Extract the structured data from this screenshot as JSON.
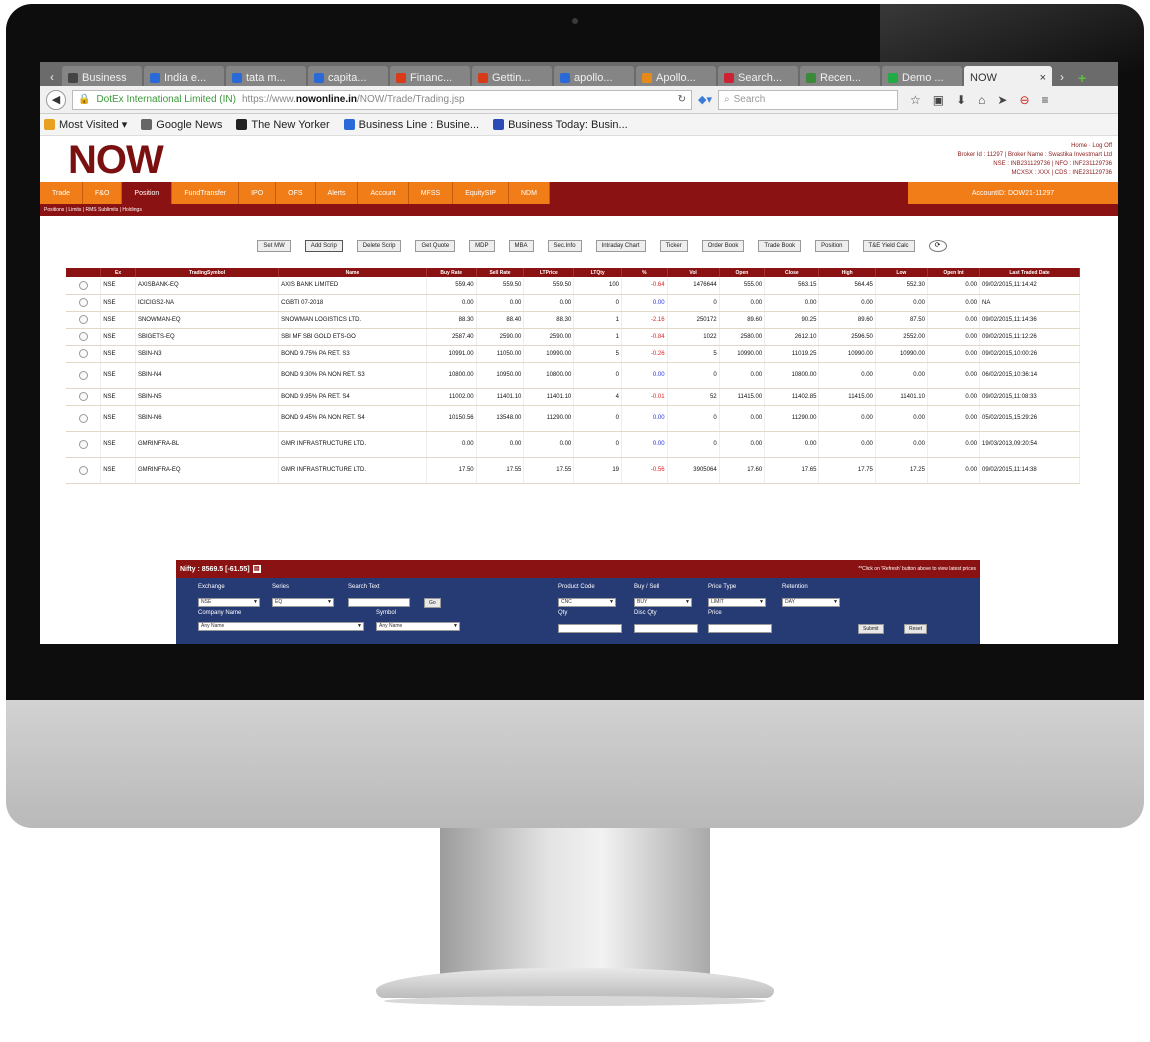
{
  "browser": {
    "tabs": [
      {
        "label": "Business",
        "color": "#444444"
      },
      {
        "label": "India e...",
        "color": "#2a6ad8"
      },
      {
        "label": "tata m...",
        "color": "#2a6ad8"
      },
      {
        "label": "capita...",
        "color": "#2a6ad8"
      },
      {
        "label": "Financ...",
        "color": "#d83a1a"
      },
      {
        "label": "Gettin...",
        "color": "#d83a1a"
      },
      {
        "label": "apollo...",
        "color": "#2a6ad8"
      },
      {
        "label": "Apollo...",
        "color": "#e88a1a"
      },
      {
        "label": "Search...",
        "color": "#cc2233"
      },
      {
        "label": "Recen...",
        "color": "#3a8a3a"
      },
      {
        "label": "Demo ...",
        "color": "#22aa44"
      }
    ],
    "active_tab": {
      "label": "NOW",
      "close": "×"
    },
    "url_site": "DotEx International Limited (IN)",
    "url_prefix": "https://www.",
    "url_host": "nowonline.in",
    "url_path": "/NOW/Trade/Trading.jsp",
    "search_placeholder": "Search",
    "bookmarks": [
      {
        "label": "Most Visited ▾",
        "color": "#e8a020"
      },
      {
        "label": "Google News",
        "color": "#666666"
      },
      {
        "label": "The New Yorker",
        "color": "#222222"
      },
      {
        "label": "Business Line : Busine...",
        "color": "#2a6ad8"
      },
      {
        "label": "Business Today: Busin...",
        "color": "#2a4ab8"
      }
    ]
  },
  "app": {
    "logo": "NOW",
    "user_line1": "Home · Log Off",
    "user_line2": "Broker Id : 11297 | Broker Name : Swastika Investmart Ltd",
    "user_line3": "NSE : INB231129736 | NFO : INF231129736",
    "user_line4": "MCXSX : XXX | CDS : INE231129736",
    "menu": [
      "Trade",
      "F&O",
      "Position",
      "FundTransfer",
      "IPO",
      "OFS",
      "Alerts",
      "Account",
      "MFSS",
      "EquitySIP",
      "NDM"
    ],
    "account": "AccountID: DOW21-11297",
    "subnav": "Positions | Limits | RMS Sublimits | Holdings",
    "toolbar": [
      "Set MW",
      "Add Scrip",
      "Delete Scrip",
      "Get Quote",
      "MDP",
      "MBA",
      "Sec.Info",
      "Intraday Chart",
      "Ticker",
      "Order Book",
      "Trade Book",
      "Position",
      "T&E Yield Calc"
    ],
    "refresh_icon": "refresh-icon",
    "columns": [
      "",
      "Ex",
      "TradingSymbol",
      "Name",
      "Buy Rate",
      "Sell Rate",
      "LTPrice",
      "LTQty",
      "%",
      "Vol",
      "Open",
      "Close",
      "High",
      "Low",
      "Open Int",
      "Last Traded Date"
    ],
    "rows": [
      {
        "ex": "NSE",
        "sym": "AXISBANK-EQ",
        "name": "AXIS BANK LIMITED",
        "buy": "559.40",
        "sell": "559.50",
        "ltp": "559.50",
        "ltq": "100",
        "pct": "-0.64",
        "dir": "neg",
        "vol": "1476644",
        "open": "555.00",
        "close": "563.15",
        "high": "564.45",
        "low": "552.30",
        "oi": "0.00",
        "date": "09/02/2015,11:14:42"
      },
      {
        "ex": "NSE",
        "sym": "ICICIGS2-NA",
        "name": "CGBTI 07-2018",
        "buy": "0.00",
        "sell": "0.00",
        "ltp": "0.00",
        "ltq": "0",
        "pct": "0.00",
        "dir": "pos",
        "vol": "0",
        "open": "0.00",
        "close": "0.00",
        "high": "0.00",
        "low": "0.00",
        "oi": "0.00",
        "date": "NA"
      },
      {
        "ex": "NSE",
        "sym": "SNOWMAN-EQ",
        "name": "SNOWMAN LOGISTICS LTD.",
        "buy": "88.30",
        "sell": "88.40",
        "ltp": "88.30",
        "ltq": "1",
        "pct": "-2.16",
        "dir": "neg",
        "vol": "250172",
        "open": "89.60",
        "close": "90.25",
        "high": "89.60",
        "low": "87.50",
        "oi": "0.00",
        "date": "09/02/2015,11:14:36"
      },
      {
        "ex": "NSE",
        "sym": "SBIGETS-EQ",
        "name": "SBI MF SBI GOLD ETS-GO",
        "buy": "2587.40",
        "sell": "2590.00",
        "ltp": "2590.00",
        "ltq": "1",
        "pct": "-0.84",
        "dir": "neg",
        "vol": "1022",
        "open": "2580.00",
        "close": "2612.10",
        "high": "2596.50",
        "low": "2552.00",
        "oi": "0.00",
        "date": "09/02/2015,11:12:26"
      },
      {
        "ex": "NSE",
        "sym": "SBIN-N3",
        "name": "BOND 9.75% PA RET. S3",
        "buy": "10991.00",
        "sell": "11050.00",
        "ltp": "10990.00",
        "ltq": "5",
        "pct": "-0.26",
        "dir": "neg",
        "vol": "5",
        "open": "10990.00",
        "close": "11019.25",
        "high": "10990.00",
        "low": "10990.00",
        "oi": "0.00",
        "date": "09/02/2015,10:00:26"
      },
      {
        "ex": "NSE",
        "sym": "SBIN-N4",
        "name": "BOND 9.30% PA NON RET. S3",
        "buy": "10800.00",
        "sell": "10950.00",
        "ltp": "10800.00",
        "ltq": "0",
        "pct": "0.00",
        "dir": "pos",
        "vol": "0",
        "open": "0.00",
        "close": "10800.00",
        "high": "0.00",
        "low": "0.00",
        "oi": "0.00",
        "date": "06/02/2015,10:36:14",
        "tall": true
      },
      {
        "ex": "NSE",
        "sym": "SBIN-N5",
        "name": "BOND 9.95% PA RET. S4",
        "buy": "11002.00",
        "sell": "11401.10",
        "ltp": "11401.10",
        "ltq": "4",
        "pct": "-0.01",
        "dir": "neg",
        "vol": "52",
        "open": "11415.00",
        "close": "11402.85",
        "high": "11415.00",
        "low": "11401.10",
        "oi": "0.00",
        "date": "09/02/2015,11:08:33"
      },
      {
        "ex": "NSE",
        "sym": "SBIN-N6",
        "name": "BOND 9.45% PA NON RET. S4",
        "buy": "10150.56",
        "sell": "13548.00",
        "ltp": "11290.00",
        "ltq": "0",
        "pct": "0.00",
        "dir": "pos",
        "vol": "0",
        "open": "0.00",
        "close": "11290.00",
        "high": "0.00",
        "low": "0.00",
        "oi": "0.00",
        "date": "05/02/2015,15:29:26",
        "tall": true
      },
      {
        "ex": "NSE",
        "sym": "GMRINFRA-BL",
        "name": "GMR INFRASTRUCTURE LTD.",
        "buy": "0.00",
        "sell": "0.00",
        "ltp": "0.00",
        "ltq": "0",
        "pct": "0.00",
        "dir": "pos",
        "vol": "0",
        "open": "0.00",
        "close": "0.00",
        "high": "0.00",
        "low": "0.00",
        "oi": "0.00",
        "date": "19/03/2013,09:20:54",
        "tall": true
      },
      {
        "ex": "NSE",
        "sym": "GMRINFRA-EQ",
        "name": "GMR INFRASTRUCTURE LTD.",
        "buy": "17.50",
        "sell": "17.55",
        "ltp": "17.55",
        "ltq": "19",
        "pct": "-0.56",
        "dir": "neg",
        "vol": "3905064",
        "open": "17.60",
        "close": "17.65",
        "high": "17.75",
        "low": "17.25",
        "oi": "0.00",
        "date": "09/02/2015,11:14:38",
        "tall": true
      }
    ]
  },
  "order": {
    "nifty": "Nifty : 8569.5 [-61.55]",
    "hint": "**Click on 'Refresh' button above to view latest prices",
    "exchange_label": "Exchange",
    "exchange_value": "NSE",
    "series_label": "Series",
    "series_value": "EQ",
    "search_label": "Search Text",
    "go": "Go",
    "company_label": "Company Name",
    "company_value": "Any Name",
    "symbol_label": "Symbol",
    "symbol_value": "Any Name",
    "product_label": "Product Code",
    "product_value": "CNC",
    "qty_label": "Qty",
    "buysell_label": "Buy / Sell",
    "buysell_value": "BUY",
    "discqty_label": "Disc Qty",
    "pricetype_label": "Price Type",
    "pricetype_value": "LIMIT",
    "price_label": "Price",
    "retention_label": "Retention",
    "retention_value": "DAY",
    "submit": "Submit",
    "reset": "Reset"
  }
}
